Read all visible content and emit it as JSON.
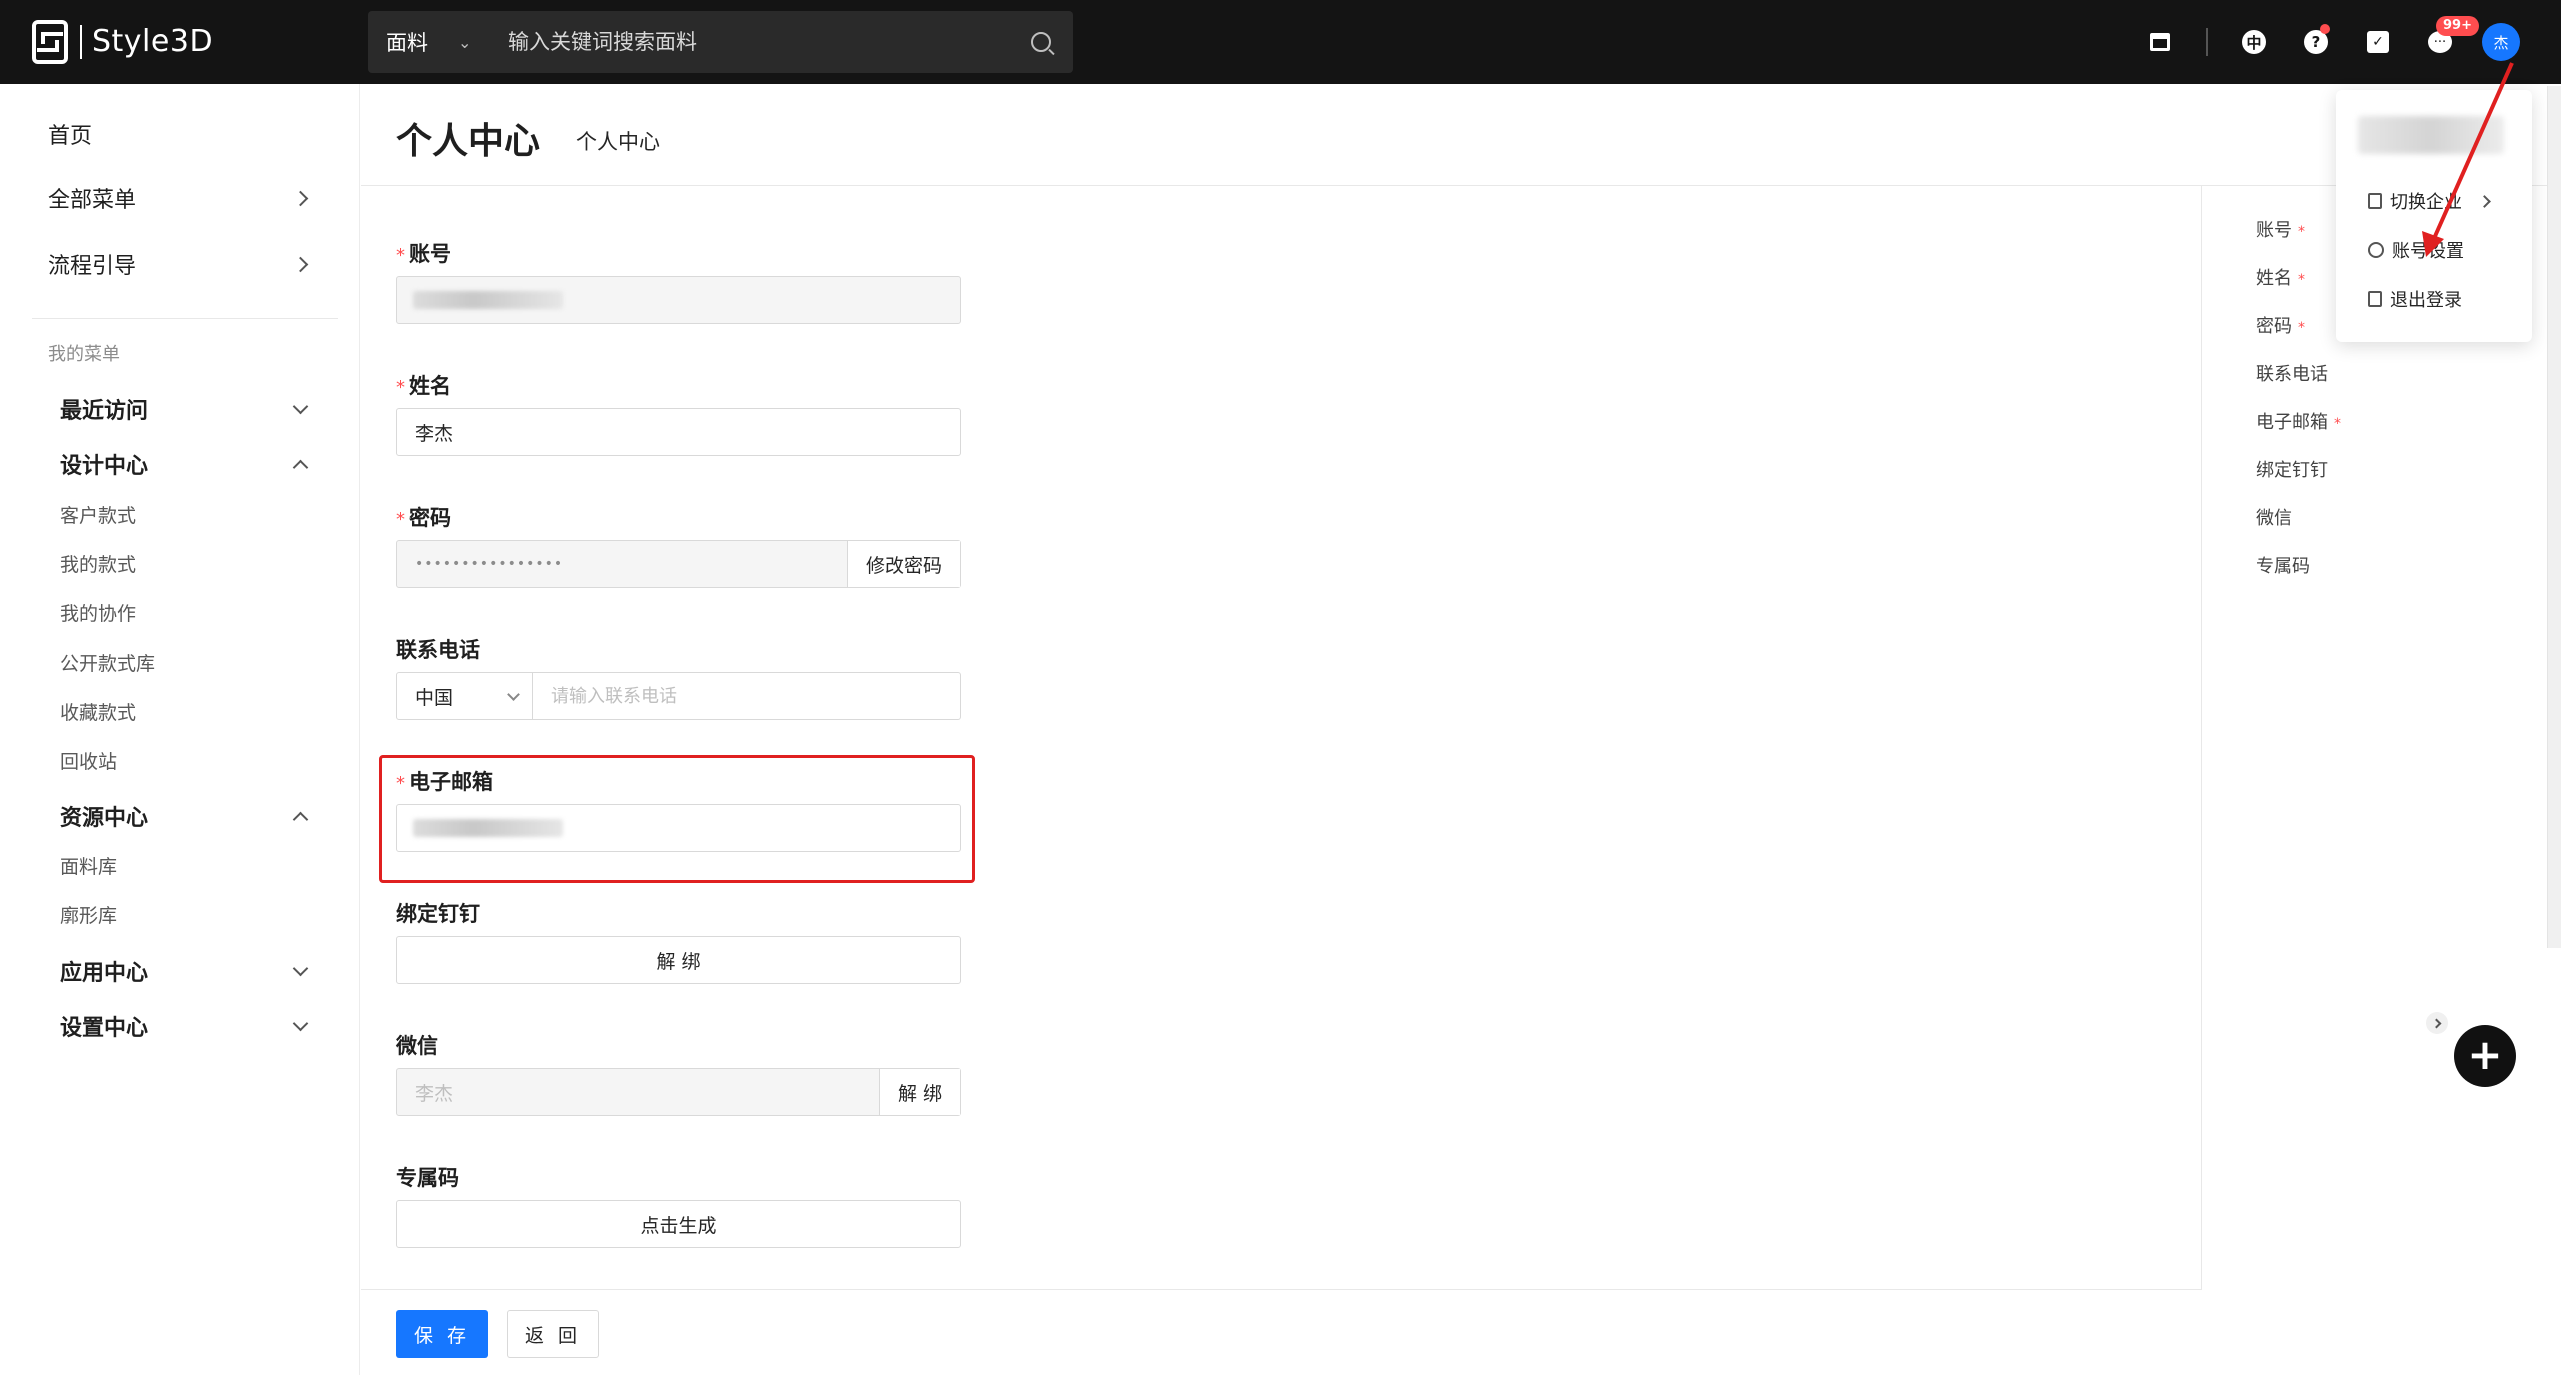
{
  "topbar": {
    "logo_text": "Style3D",
    "search": {
      "category": "面料",
      "placeholder": "输入关键词搜索面料"
    },
    "notification_badge": "99+",
    "avatar_text": "杰",
    "icons": [
      "store-icon",
      "lang-icon",
      "help-icon",
      "task-icon",
      "message-icon"
    ]
  },
  "sidebar": {
    "top_items": [
      {
        "label": "首页"
      },
      {
        "label": "全部菜单"
      },
      {
        "label": "流程引导"
      }
    ],
    "section_caption": "我的菜单",
    "groups": {
      "recent": "最近访问",
      "design": "设计中心",
      "design_items": [
        "客户款式",
        "我的款式",
        "我的协作",
        "公开款式库",
        "收藏款式",
        "回收站"
      ],
      "resource": "资源中心",
      "resource_items": [
        "面料库",
        "廓形库"
      ],
      "app": "应用中心",
      "settings": "设置中心"
    }
  },
  "page": {
    "title": "个人中心",
    "breadcrumb": "个人中心"
  },
  "form": {
    "account_label": "账号",
    "name_label": "姓名",
    "name_value": "李杰",
    "password_label": "密码",
    "password_mask": "••••••••••••••••",
    "change_password": "修改密码",
    "phone_label": "联系电话",
    "phone_country": "中国",
    "phone_placeholder": "请输入联系电话",
    "email_label": "电子邮箱",
    "dingtalk_label": "绑定钉钉",
    "dingtalk_unbind": "解 绑",
    "wechat_label": "微信",
    "wechat_value": "李杰",
    "wechat_unbind": "解 绑",
    "code_label": "专属码",
    "code_generate": "点击生成",
    "save": "保 存",
    "back": "返 回"
  },
  "anchors": [
    "账号",
    "姓名",
    "密码",
    "联系电话",
    "电子邮箱",
    "绑定钉钉",
    "微信",
    "专属码"
  ],
  "dropdown": {
    "switch_company": "切换企业",
    "account_settings": "账号设置",
    "logout": "退出登录"
  },
  "colors": {
    "topbar_bg": "#141414",
    "primary": "#1677ff",
    "highlight": "#e02020",
    "required": "#ff4d4f"
  }
}
